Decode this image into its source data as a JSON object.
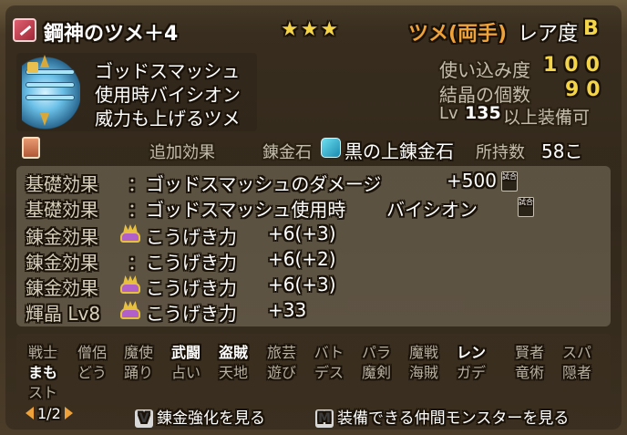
{
  "header": {
    "item_name": "鋼神のツメ＋4",
    "stars": "★★★",
    "equip_type": "ツメ(両手)",
    "rarity_label": "レア度",
    "rarity_value": "B"
  },
  "description": [
    "ゴッドスマッシュ",
    "使用時バイシオン",
    "威力も上げるツメ"
  ],
  "stats": {
    "usage_label": "使い込み度",
    "usage_value": "100",
    "crystal_label": "結晶の個数",
    "crystal_value": "90",
    "level_text": "Lv",
    "level_value": "135",
    "level_suffix": "以上装備可"
  },
  "alchemy": {
    "additional_label": "追加効果",
    "stone_label": "錬金石",
    "stone_name": "黒の上錬金石",
    "owned_label": "所持数",
    "owned_value": "58こ"
  },
  "effects": [
    {
      "label": "基礎効果",
      "text": "ゴッドスマッシュのダメージ",
      "value": "+500",
      "badge": "試合無効"
    },
    {
      "label": "基礎効果",
      "text": "ゴッドスマッシュ使用時",
      "value": "バイシオン",
      "badge": "試合無効"
    },
    {
      "label": "錬金効果",
      "text": "こうげき力",
      "value": "+6(+3)"
    },
    {
      "label": "錬金効果",
      "text": "こうげき力",
      "value": "+6(+2)"
    },
    {
      "label": "錬金効果",
      "text": "こうげき力",
      "value": "+6(+3)"
    },
    {
      "label": "輝晶 Lv8",
      "text": "こうげき力",
      "value": "+33"
    }
  ],
  "colon": "：",
  "jobs": {
    "row1": [
      "戦士",
      "僧侶",
      "魔使",
      "武闘",
      "盗賊",
      "旅芸",
      "バト",
      "パラ",
      "魔戦",
      "レン",
      "賢者",
      "スパ"
    ],
    "row2": [
      "まも",
      "どう",
      "踊り",
      "占い",
      "天地",
      "遊び",
      "デス",
      "魔剣",
      "海賊",
      "ガデ",
      "竜術",
      "隠者"
    ],
    "row3": [
      "スト"
    ]
  },
  "footer": {
    "page": "1/2",
    "v_key": "V",
    "v_label": "錬金強化を見る",
    "m_key": "M",
    "m_label": "装備できる仲間モンスターを見る"
  },
  "colors": {
    "gold": "#f4d448",
    "orange": "#f0a23a",
    "gray": "#c4bcac"
  }
}
